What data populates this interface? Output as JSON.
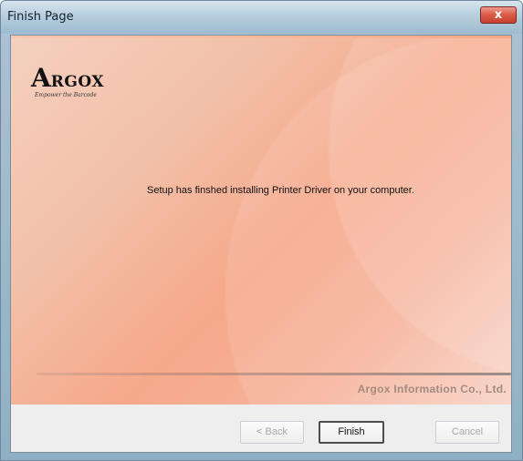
{
  "window": {
    "title": "Finish Page",
    "close_label": "x"
  },
  "logo": {
    "first_letter": "A",
    "rest": "RGOX",
    "slogan": "Empower the Barcode"
  },
  "message": {
    "text": "Setup has finshed installing Printer Driver on your computer."
  },
  "footer": {
    "company": "Argox Information Co., Ltd."
  },
  "buttons": {
    "back": "< Back",
    "finish": "Finish",
    "cancel": "Cancel"
  },
  "colors": {
    "title_bar": "#b7cedd",
    "close_button": "#d85b47",
    "banner_main": "#f6a88a",
    "company_text": "#a48b7f"
  }
}
